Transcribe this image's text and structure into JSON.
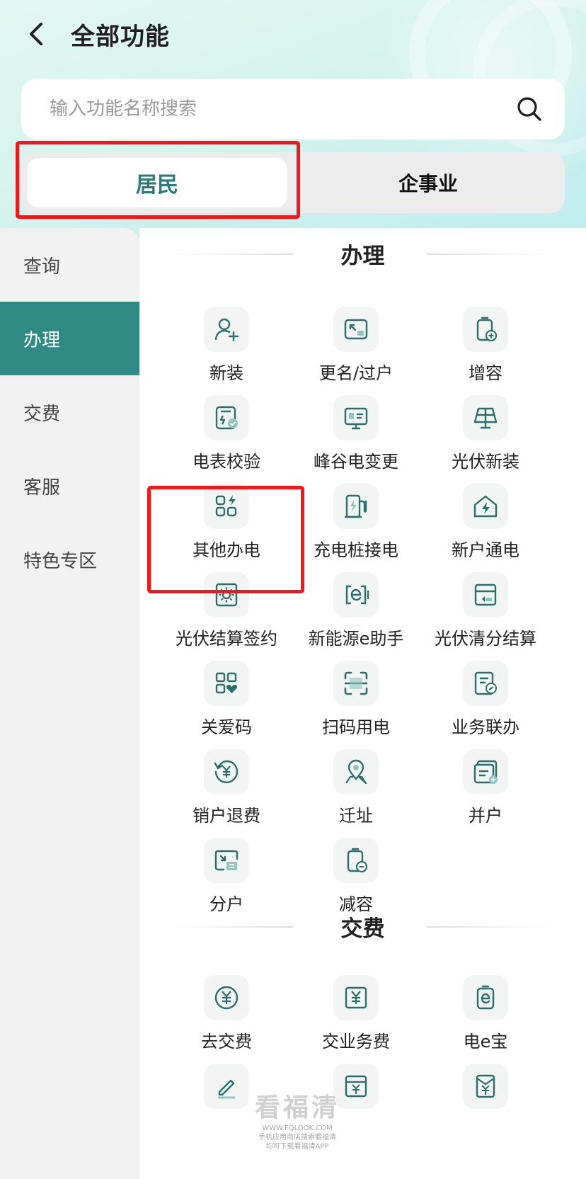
{
  "header": {
    "title": "全部功能"
  },
  "search": {
    "placeholder": "输入功能名称搜索"
  },
  "segments": {
    "active": "居民",
    "inactive": "企事业"
  },
  "sidebar": {
    "items": [
      {
        "label": "查询"
      },
      {
        "label": "办理",
        "active": true
      },
      {
        "label": "交费"
      },
      {
        "label": "客服"
      },
      {
        "label": "特色专区"
      }
    ]
  },
  "sections": [
    {
      "title": "办理",
      "items": [
        {
          "label": "新装",
          "icon": "add-user-icon"
        },
        {
          "label": "更名/过户",
          "icon": "transfer-icon"
        },
        {
          "label": "增容",
          "icon": "battery-plus-icon"
        },
        {
          "label": "电表校验",
          "icon": "meter-check-icon"
        },
        {
          "label": "峰谷电变更",
          "icon": "board-icon"
        },
        {
          "label": "光伏新装",
          "icon": "solar-panel-icon"
        },
        {
          "label": "其他办电",
          "icon": "apps-bolt-icon"
        },
        {
          "label": "充电桩接电",
          "icon": "charger-icon"
        },
        {
          "label": "新户通电",
          "icon": "house-bolt-icon"
        },
        {
          "label": "光伏结算签约",
          "icon": "sun-contract-icon"
        },
        {
          "label": "新能源e助手",
          "icon": "e-battery-icon"
        },
        {
          "label": "光伏清分结算",
          "icon": "card-icon"
        },
        {
          "label": "关爱码",
          "icon": "qr-heart-icon"
        },
        {
          "label": "扫码用电",
          "icon": "scan-icon"
        },
        {
          "label": "业务联办",
          "icon": "doc-link-icon"
        },
        {
          "label": "销户退费",
          "icon": "yuan-refund-icon"
        },
        {
          "label": "迁址",
          "icon": "location-icon"
        },
        {
          "label": "并户",
          "icon": "merge-icon"
        },
        {
          "label": "分户",
          "icon": "split-icon"
        },
        {
          "label": "减容",
          "icon": "battery-minus-icon"
        }
      ]
    },
    {
      "title": "交费",
      "items": [
        {
          "label": "去交费",
          "icon": "yuan-circle-icon"
        },
        {
          "label": "交业务费",
          "icon": "yuan-square-icon"
        },
        {
          "label": "电e宝",
          "icon": "e-wallet-icon"
        }
      ]
    }
  ],
  "partial_icons": [
    "pen-icon",
    "yuan-card-icon",
    "yuan-envelope-icon"
  ],
  "watermark": {
    "title": "看福清",
    "url": "WWW.FQLOOK.COM",
    "line1": "手机应用商店搜索看福清",
    "line2": "均可下载看福清APP"
  },
  "colors": {
    "accent": "#2f8a84",
    "highlight": "#f01818",
    "icon": "#2b6f6b"
  }
}
